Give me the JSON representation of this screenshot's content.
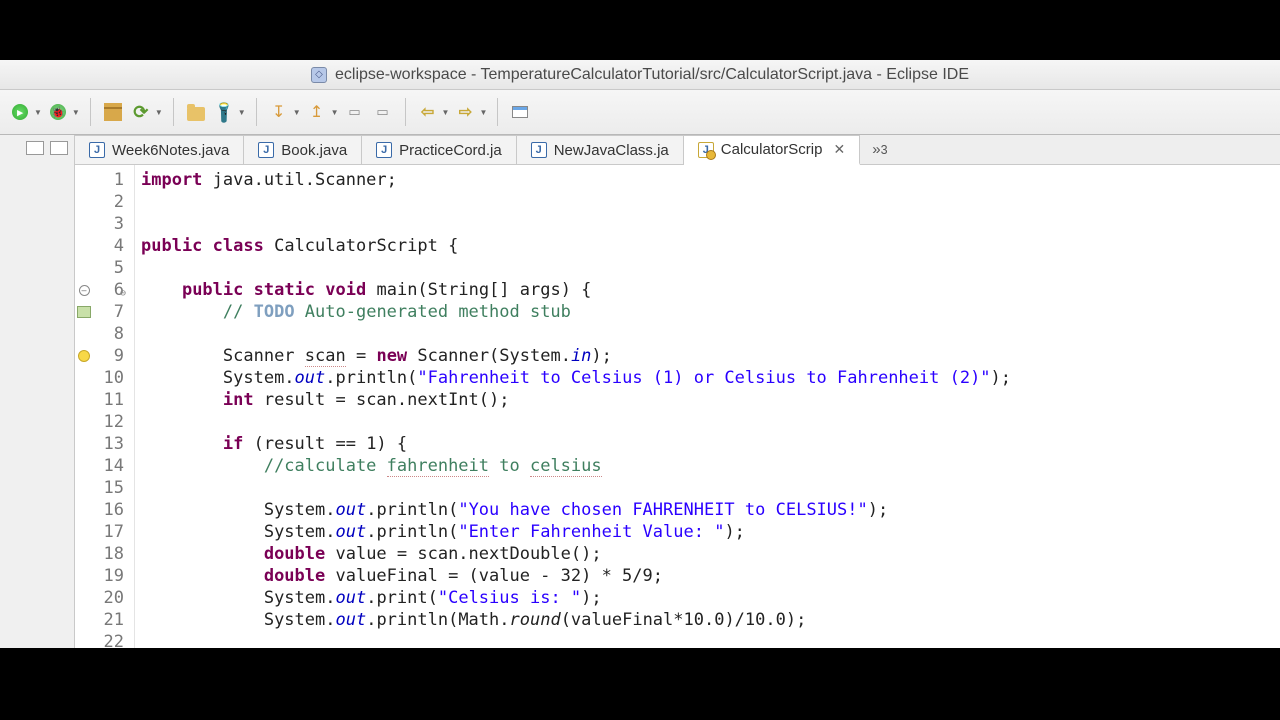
{
  "window": {
    "title": "eclipse-workspace - TemperatureCalculatorTutorial/src/CalculatorScript.java - Eclipse IDE"
  },
  "tabs": [
    {
      "label": "Week6Notes.java",
      "warn": false,
      "active": false
    },
    {
      "label": "Book.java",
      "warn": false,
      "active": false
    },
    {
      "label": "PracticeCord.ja",
      "warn": false,
      "active": false
    },
    {
      "label": "NewJavaClass.ja",
      "warn": false,
      "active": false
    },
    {
      "label": "CalculatorScrip",
      "warn": true,
      "active": true
    }
  ],
  "overflow": "»₃",
  "overflow_count": "3",
  "line_numbers": [
    "1",
    "2",
    "3",
    "4",
    "5",
    "6",
    "7",
    "8",
    "9",
    "10",
    "11",
    "12",
    "13",
    "14",
    "15",
    "16",
    "17",
    "18",
    "19",
    "20",
    "21",
    "22"
  ],
  "markers": {
    "6": "minus",
    "7": "note",
    "9": "bulb"
  },
  "code": {
    "l1": {
      "kw1": "import",
      "rest": " java.util.Scanner;"
    },
    "l4": {
      "kw1": "public",
      "kw2": "class",
      "name": " CalculatorScript {"
    },
    "l6": {
      "indent": "    ",
      "kw1": "public",
      "kw2": "static",
      "kw3": "void",
      "sig": " main(String[] args) {"
    },
    "l7": {
      "indent": "        ",
      "c1": "// ",
      "todo": "TODO",
      "c2": " Auto-generated method stub"
    },
    "l9": {
      "indent": "        ",
      "t1": "Scanner ",
      "v1": "scan",
      "t2": " = ",
      "kw": "new",
      "t3": " Scanner(System.",
      "fld": "in",
      "t4": ");"
    },
    "l10": {
      "indent": "        ",
      "t1": "System.",
      "fld": "out",
      "t2": ".println(",
      "str": "\"Fahrenheit to Celsius (1) or Celsius to Fahrenheit (2)\"",
      "t3": ");"
    },
    "l11": {
      "indent": "        ",
      "kw": "int",
      "t1": " result = scan.nextInt();"
    },
    "l13": {
      "indent": "        ",
      "kw": "if",
      "t1": " (result == 1) {"
    },
    "l14": {
      "indent": "            ",
      "c1": "//calculate ",
      "s1": "fahrenheit",
      "c2": " to ",
      "s2": "celsius"
    },
    "l16": {
      "indent": "            ",
      "t1": "System.",
      "fld": "out",
      "t2": ".println(",
      "str": "\"You have chosen FAHRENHEIT to CELSIUS!\"",
      "t3": ");"
    },
    "l17": {
      "indent": "            ",
      "t1": "System.",
      "fld": "out",
      "t2": ".println(",
      "str": "\"Enter Fahrenheit Value: \"",
      "t3": ");"
    },
    "l18": {
      "indent": "            ",
      "kw": "double",
      "t1": " value = scan.nextDouble();"
    },
    "l19": {
      "indent": "            ",
      "kw": "double",
      "t1": " valueFinal = (value - 32) * 5/9;"
    },
    "l20": {
      "indent": "            ",
      "t1": "System.",
      "fld": "out",
      "t2": ".print(",
      "str": "\"Celsius is: \"",
      "t3": ");"
    },
    "l21": {
      "indent": "            ",
      "t1": "System.",
      "fld": "out",
      "t2": ".println(Math.",
      "m": "round",
      "t3": "(valueFinal*10.0)/10.0);"
    }
  }
}
